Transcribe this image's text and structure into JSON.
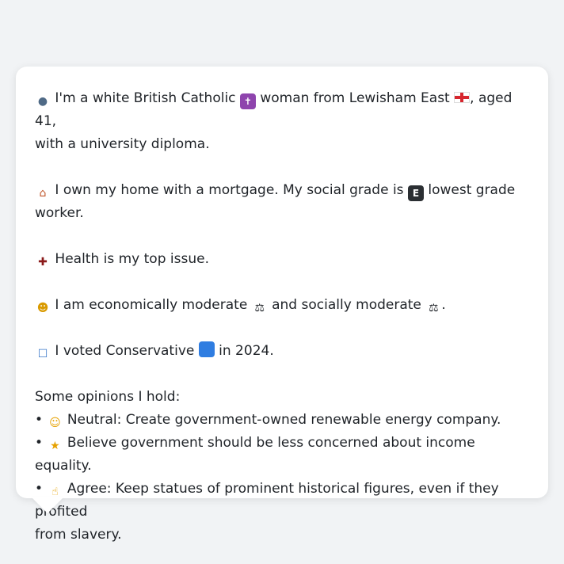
{
  "profile": {
    "line1_prefix": "I'm a white British Catholic",
    "line1_mid": "woman from Lewisham East",
    "line1_suffix": ", aged 41,",
    "line2": "with a university diploma.",
    "home_prefix": "I own my home with a mortgage. My social grade is",
    "home_suffix": "lowest grade",
    "home_line2": "worker.",
    "issue": "Health is my top issue.",
    "econ_prefix": "I am economically moderate",
    "econ_mid": "and socially moderate",
    "econ_end": ".",
    "vote_prefix": "I voted Conservative",
    "vote_suffix": "in 2024.",
    "grade_letter": "E"
  },
  "icons": {
    "person": "person-silhouette-icon",
    "cross": "latin-cross-icon",
    "flag": "england-flag-icon",
    "house": "house-icon",
    "grade": "letter-e-icon",
    "hospital": "hospital-icon",
    "thinking": "thinking-face-icon",
    "scales": "balance-scale-icon",
    "ballot": "ballot-box-icon",
    "party": "blue-square-icon",
    "neutral": "neutral-face-icon",
    "shrug": "person-shrugging-icon",
    "thumbs": "thumbs-up-icon"
  },
  "opinions": {
    "heading": "Some opinions I hold:",
    "items": [
      {
        "bullet": "•",
        "text": "Neutral: Create government-owned renewable energy company."
      },
      {
        "bullet": "•",
        "text": "Believe government should be less concerned about income equality."
      },
      {
        "bullet": "•",
        "text": "Agree: Keep statues of prominent historical figures, even if they profited"
      }
    ],
    "item3_line2": "from slavery."
  },
  "colors": {
    "background": "#f1f3f5",
    "card": "#ffffff",
    "text": "#1f2328",
    "party_blue": "#2f7de1"
  }
}
